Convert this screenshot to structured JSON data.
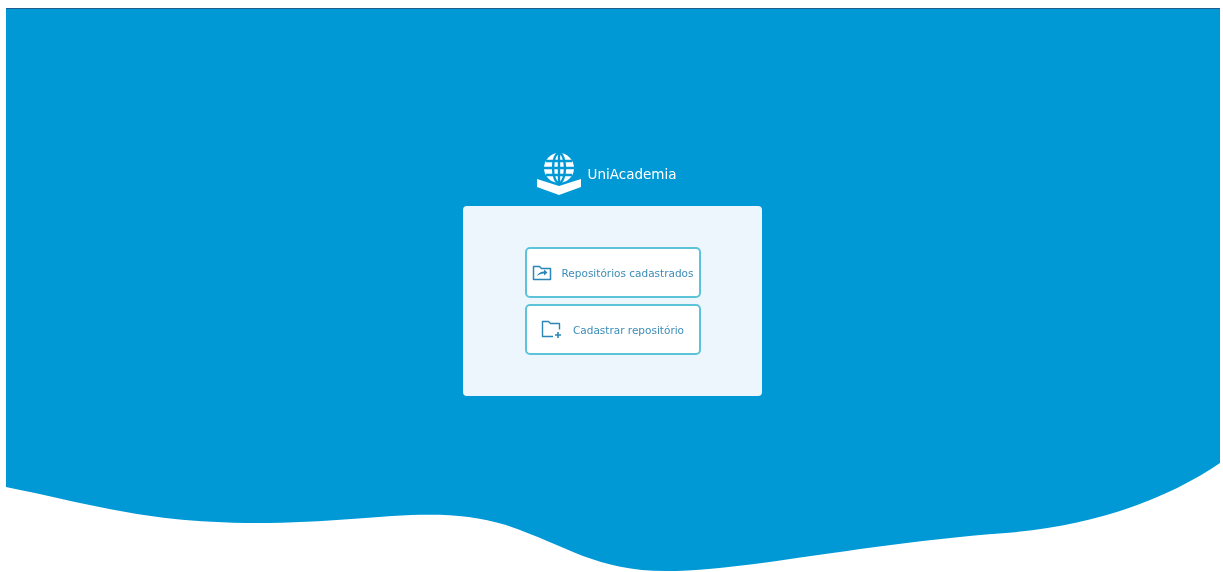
{
  "brand": {
    "name": "UniAcademia"
  },
  "actions": [
    {
      "kind": "list",
      "label": "Repositórios cadastrados"
    },
    {
      "kind": "add",
      "label": "Cadastrar repositório"
    }
  ]
}
